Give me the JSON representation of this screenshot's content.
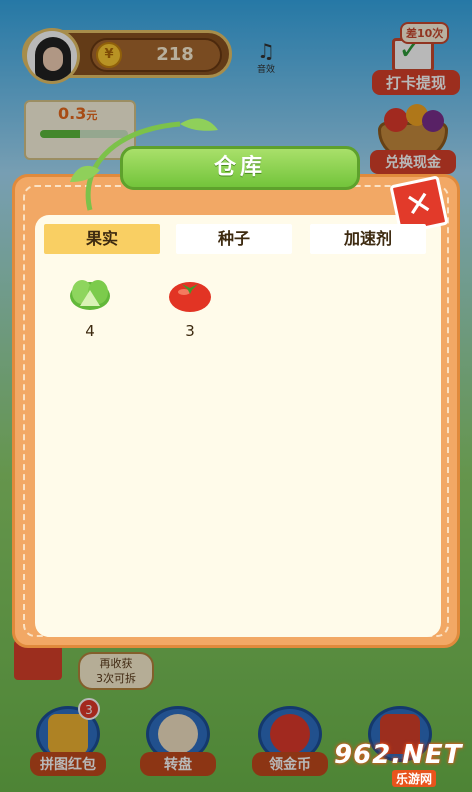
{
  "hud": {
    "coins": "218",
    "coin_icon": "coin-icon",
    "sound_label": "音效",
    "checkin_badge": "差10次",
    "checkin_label": "打卡提现",
    "money_value": "0.3",
    "money_unit": "元",
    "money_progress": 0.45,
    "exchange_label": "兑换现金"
  },
  "harvest": {
    "line1": "再收获",
    "line2": "3次可拆"
  },
  "bottom_nav": [
    {
      "label": "拼图红包",
      "icon": "puzzle-icon",
      "count": "3"
    },
    {
      "label": "转盘",
      "icon": "wheel-icon"
    },
    {
      "label": "领金币",
      "icon": "coin-bag-icon"
    },
    {
      "label": "",
      "icon": "gift-icon"
    }
  ],
  "watermark": {
    "big": "962.NET",
    "small": "乐游网"
  },
  "modal": {
    "title": "仓库",
    "close_glyph": "✕",
    "tabs": [
      {
        "label": "果实",
        "active": true
      },
      {
        "label": "种子",
        "active": false
      },
      {
        "label": "加速剂",
        "active": false
      }
    ],
    "items": [
      {
        "name": "lettuce",
        "icon": "lettuce-icon",
        "count": "4"
      },
      {
        "name": "tomato",
        "icon": "tomato-icon",
        "count": "3"
      }
    ]
  },
  "colors": {
    "modal_bg": "#f2a865",
    "inner_bg": "#fffbea",
    "title_green": "#73c43b",
    "tab_active": "#f9cf63",
    "close_red": "#e23a2a"
  }
}
